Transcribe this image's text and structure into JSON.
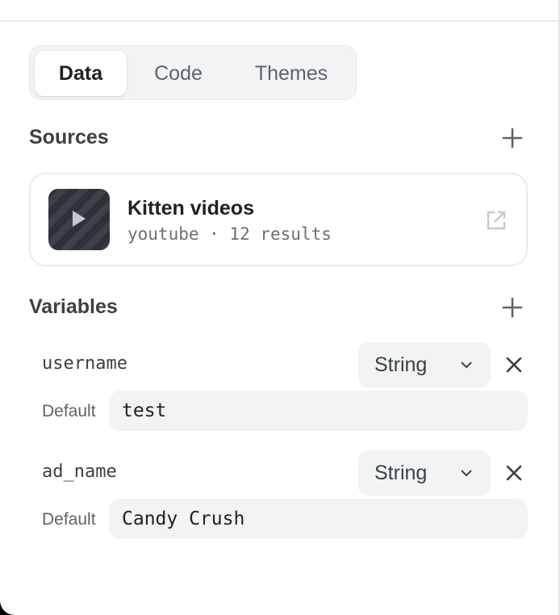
{
  "tabs": [
    {
      "label": "Data",
      "active": true
    },
    {
      "label": "Code",
      "active": false
    },
    {
      "label": "Themes",
      "active": false
    }
  ],
  "sources": {
    "title": "Sources",
    "add_icon": "plus-icon",
    "items": [
      {
        "name": "Kitten videos",
        "meta": "youtube · 12 results",
        "thumbnail_icon": "play-icon",
        "open_icon": "external-link-icon"
      }
    ]
  },
  "variables": {
    "title": "Variables",
    "add_icon": "plus-icon",
    "items": [
      {
        "name": "username",
        "type": "String",
        "default_label": "Default",
        "default_value": "test"
      },
      {
        "name": "ad_name",
        "type": "String",
        "default_label": "Default",
        "default_value": "Candy Crush"
      }
    ]
  },
  "colors": {
    "panel_bg": "#ffffff",
    "surface": "#f1f3f4",
    "text_primary": "#202124",
    "text_secondary": "#5f6368"
  }
}
